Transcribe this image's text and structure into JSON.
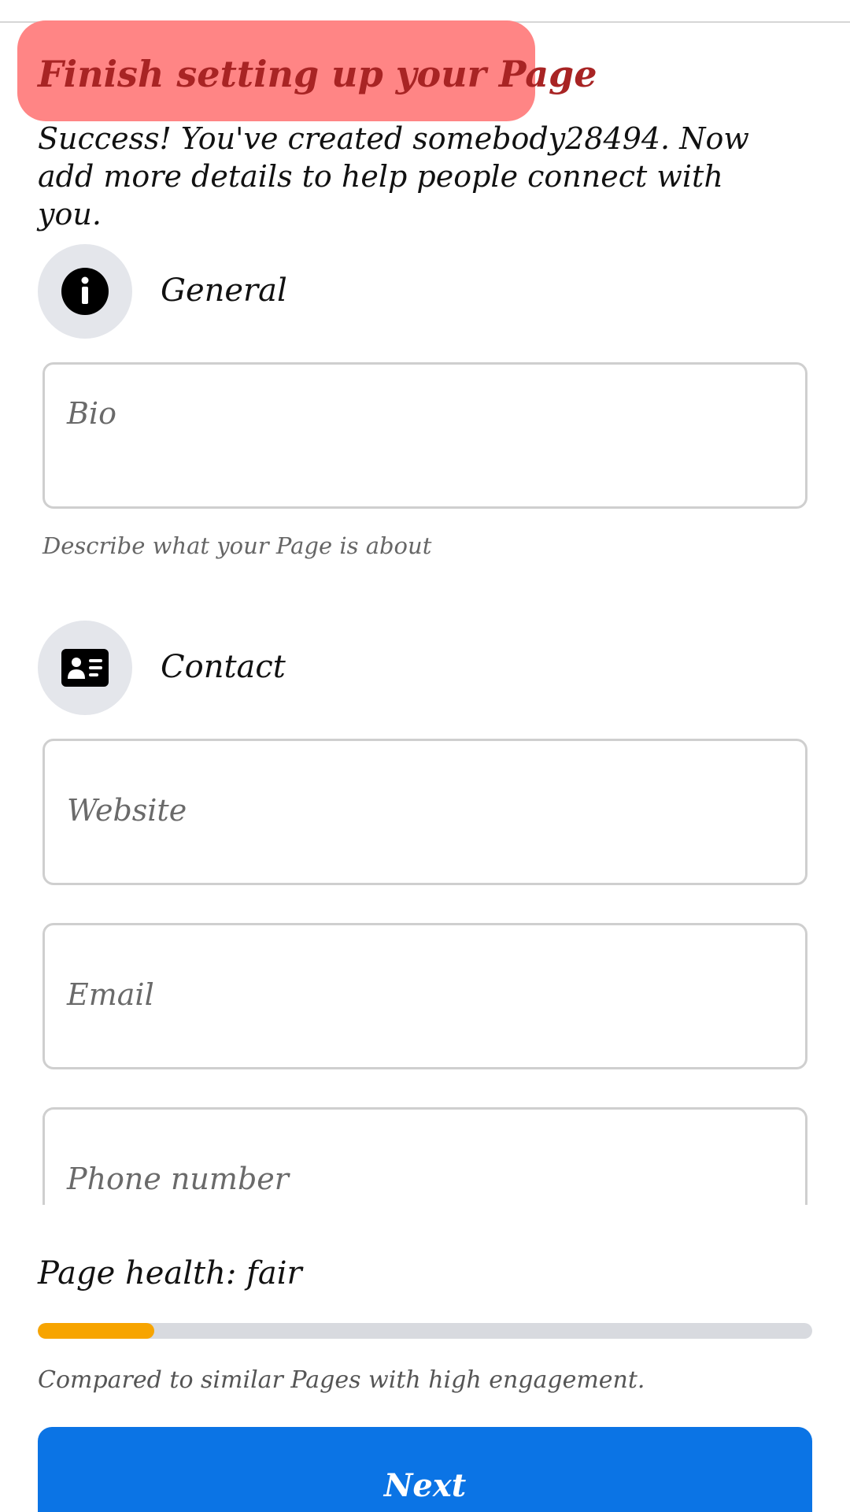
{
  "header": {
    "title": "Finish setting up your Page",
    "intro": "Success! You've created somebody28494. Now add more details to help people connect with you."
  },
  "general": {
    "title": "General",
    "icon": "info-icon",
    "bio_placeholder": "Bio",
    "bio_helper": "Describe what your Page is about"
  },
  "contact": {
    "title": "Contact",
    "icon": "contact-card-icon",
    "website_placeholder": "Website",
    "email_placeholder": "Email",
    "phone_placeholder": "Phone number"
  },
  "health": {
    "label": "Page health: fair",
    "progress": 0.15,
    "caption": "Compared to similar Pages with high engagement."
  },
  "actions": {
    "next_label": "Next"
  },
  "colors": {
    "title_bg": "#ff8585",
    "title_text": "#a82424",
    "progress_fill": "#f7a400",
    "progress_track": "#d8dadf",
    "primary_button": "#0b74e5"
  }
}
